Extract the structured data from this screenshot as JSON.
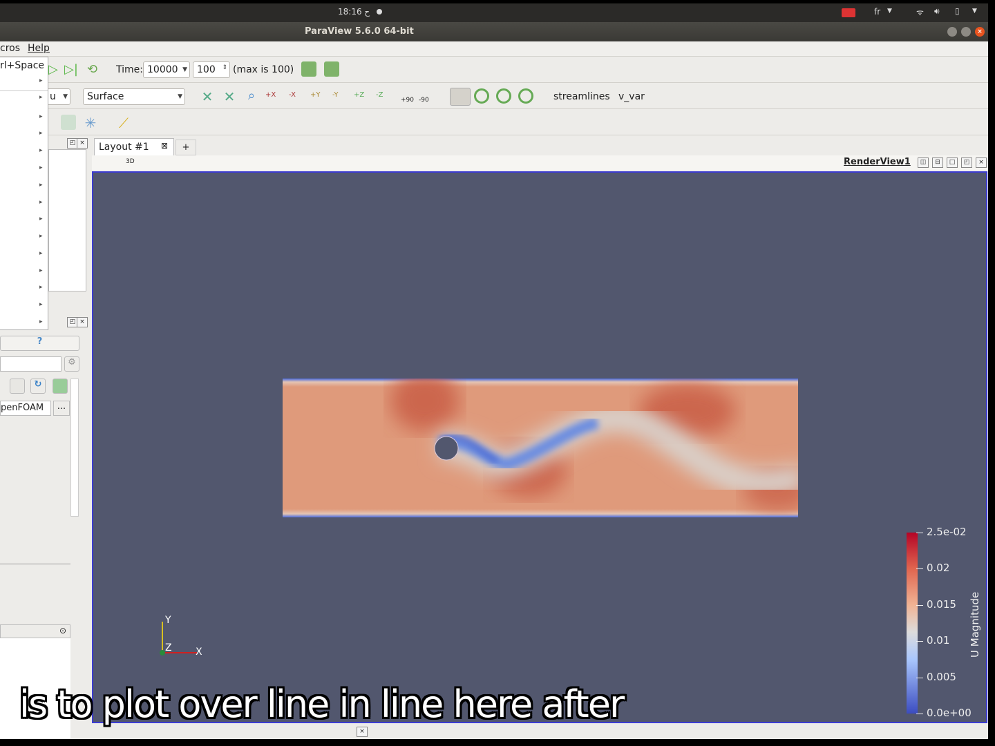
{
  "system": {
    "clock": "18:16 ح",
    "keyboard_layout": "fr"
  },
  "window": {
    "title": "ParaView 5.6.0 64-bit"
  },
  "menubar": {
    "items": [
      "cros",
      "Help"
    ]
  },
  "menu_popup": {
    "shortcut": "rl+Space"
  },
  "toolbar": {
    "time_label": "Time:",
    "time_value": "10000",
    "timestep_value": "100",
    "max_label": "(max is 100)",
    "representation_partial": "u",
    "representation": "Surface",
    "camera_labels": [
      "+X",
      "-X",
      "+Y",
      "-Y",
      "+Z",
      "-Z",
      "+90",
      "-90"
    ],
    "custom_buttons": [
      "streamlines",
      "v_var"
    ]
  },
  "left_panel": {
    "reader_name": "penFOAM",
    "more_button": "...",
    "help_icon": "?"
  },
  "layout": {
    "tab_label": "Layout #1",
    "add_tab": "+",
    "toolbar_3d": "3D",
    "view_name": "RenderView1"
  },
  "render": {
    "axes": {
      "x": "X",
      "y": "Y",
      "z": "Z"
    },
    "colorbar": {
      "title": "U Magnitude",
      "labels": [
        "2.5e-02",
        "0.02",
        "0.015",
        "0.01",
        "0.005",
        "0.0e+00"
      ],
      "range": [
        0,
        0.025
      ],
      "low_color": "#3b4cc0",
      "high_color": "#b40426"
    }
  },
  "subtitle": "is to plot over line in line here after"
}
